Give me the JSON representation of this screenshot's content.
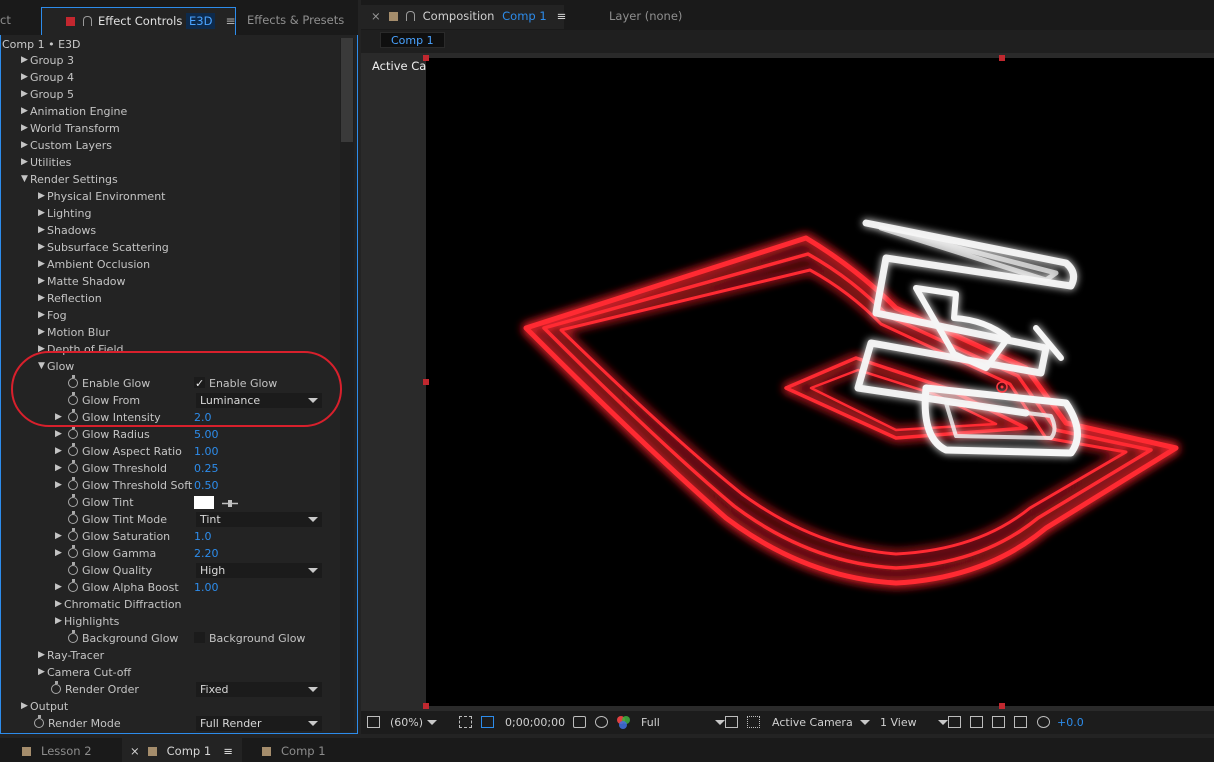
{
  "left_tabs": {
    "partial": "ct",
    "effect_controls": "Effect Controls",
    "effect_badge": "E3D",
    "effects_presets": "Effects & Presets",
    "menu": "≡"
  },
  "breadcrumb": "Comp 1 • E3D",
  "rows": [
    {
      "label": "Group 3",
      "tri": "▶"
    },
    {
      "label": "Group 4",
      "tri": "▶"
    },
    {
      "label": "Group 5",
      "tri": "▶"
    },
    {
      "label": "Animation Engine",
      "tri": "▶"
    },
    {
      "label": "World Transform",
      "tri": "▶"
    },
    {
      "label": "Custom Layers",
      "tri": "▶"
    },
    {
      "label": "Utilities",
      "tri": "▶"
    },
    {
      "label": "Render Settings",
      "tri": "▼"
    },
    {
      "label": "Physical Environment",
      "tri": "▶"
    },
    {
      "label": "Lighting",
      "tri": "▶"
    },
    {
      "label": "Shadows",
      "tri": "▶"
    },
    {
      "label": "Subsurface Scattering",
      "tri": "▶"
    },
    {
      "label": "Ambient Occlusion",
      "tri": "▶"
    },
    {
      "label": "Matte Shadow",
      "tri": "▶"
    },
    {
      "label": "Reflection",
      "tri": "▶"
    },
    {
      "label": "Fog",
      "tri": "▶"
    },
    {
      "label": "Motion Blur",
      "tri": "▶"
    },
    {
      "label": "Depth of Field",
      "tri": "▶"
    },
    {
      "label": "Glow",
      "tri": "▼"
    },
    {
      "label": "Enable Glow",
      "checkbox_label": "Enable Glow",
      "tick": "✓"
    },
    {
      "label": "Glow From",
      "dropdown": "Luminance"
    },
    {
      "label": "Glow Intensity",
      "tri": "▶",
      "value": "2.0"
    },
    {
      "label": "Glow Radius",
      "tri": "▶",
      "value": "5.00"
    },
    {
      "label": "Glow Aspect Ratio",
      "tri": "▶",
      "value": "1.00"
    },
    {
      "label": "Glow Threshold",
      "tri": "▶",
      "value": "0.25"
    },
    {
      "label": "Glow Threshold Soft",
      "tri": "▶",
      "value": "0.50"
    },
    {
      "label": "Glow Tint"
    },
    {
      "label": "Glow Tint Mode",
      "dropdown": "Tint"
    },
    {
      "label": "Glow Saturation",
      "tri": "▶",
      "value": "1.0"
    },
    {
      "label": "Glow Gamma",
      "tri": "▶",
      "value": "2.20"
    },
    {
      "label": "Glow Quality",
      "dropdown": "High"
    },
    {
      "label": "Glow Alpha Boost",
      "tri": "▶",
      "value": "1.00"
    },
    {
      "label": "Chromatic Diffraction",
      "tri": "▶"
    },
    {
      "label": "Highlights",
      "tri": "▶"
    },
    {
      "label": "Background Glow",
      "checkbox_label": "Background Glow"
    },
    {
      "label": "Ray-Tracer",
      "tri": "▶"
    },
    {
      "label": "Camera Cut-off",
      "tri": "▶"
    },
    {
      "label": "Render Order",
      "dropdown": "Fixed"
    },
    {
      "label": "Output",
      "tri": "▶"
    },
    {
      "label": "Render Mode",
      "dropdown": "Full Render"
    }
  ],
  "comp_tabs": {
    "close": "×",
    "composition": "Composition",
    "comp_name": "Comp 1",
    "menu": "≡",
    "layer": "Layer  (none)",
    "subtab": "Comp 1"
  },
  "viewer": {
    "label": "Active Camera"
  },
  "bottom_bar": {
    "zoom": "(60%)",
    "timecode": "0;00;00;00",
    "resolution": "Full",
    "camera": "Active Camera",
    "view": "1 View",
    "exposure": "+0.0"
  },
  "timeline_tabs": {
    "lesson": "Lesson 2",
    "close": "×",
    "comp_active": "Comp 1",
    "menu": "≡",
    "comp_other": "Comp 1"
  },
  "colors": {
    "accent": "#2d8ceb",
    "highlight_circle": "#d8202c",
    "neon_red": "#ff2a33",
    "neon_white": "#f5f5f5"
  }
}
